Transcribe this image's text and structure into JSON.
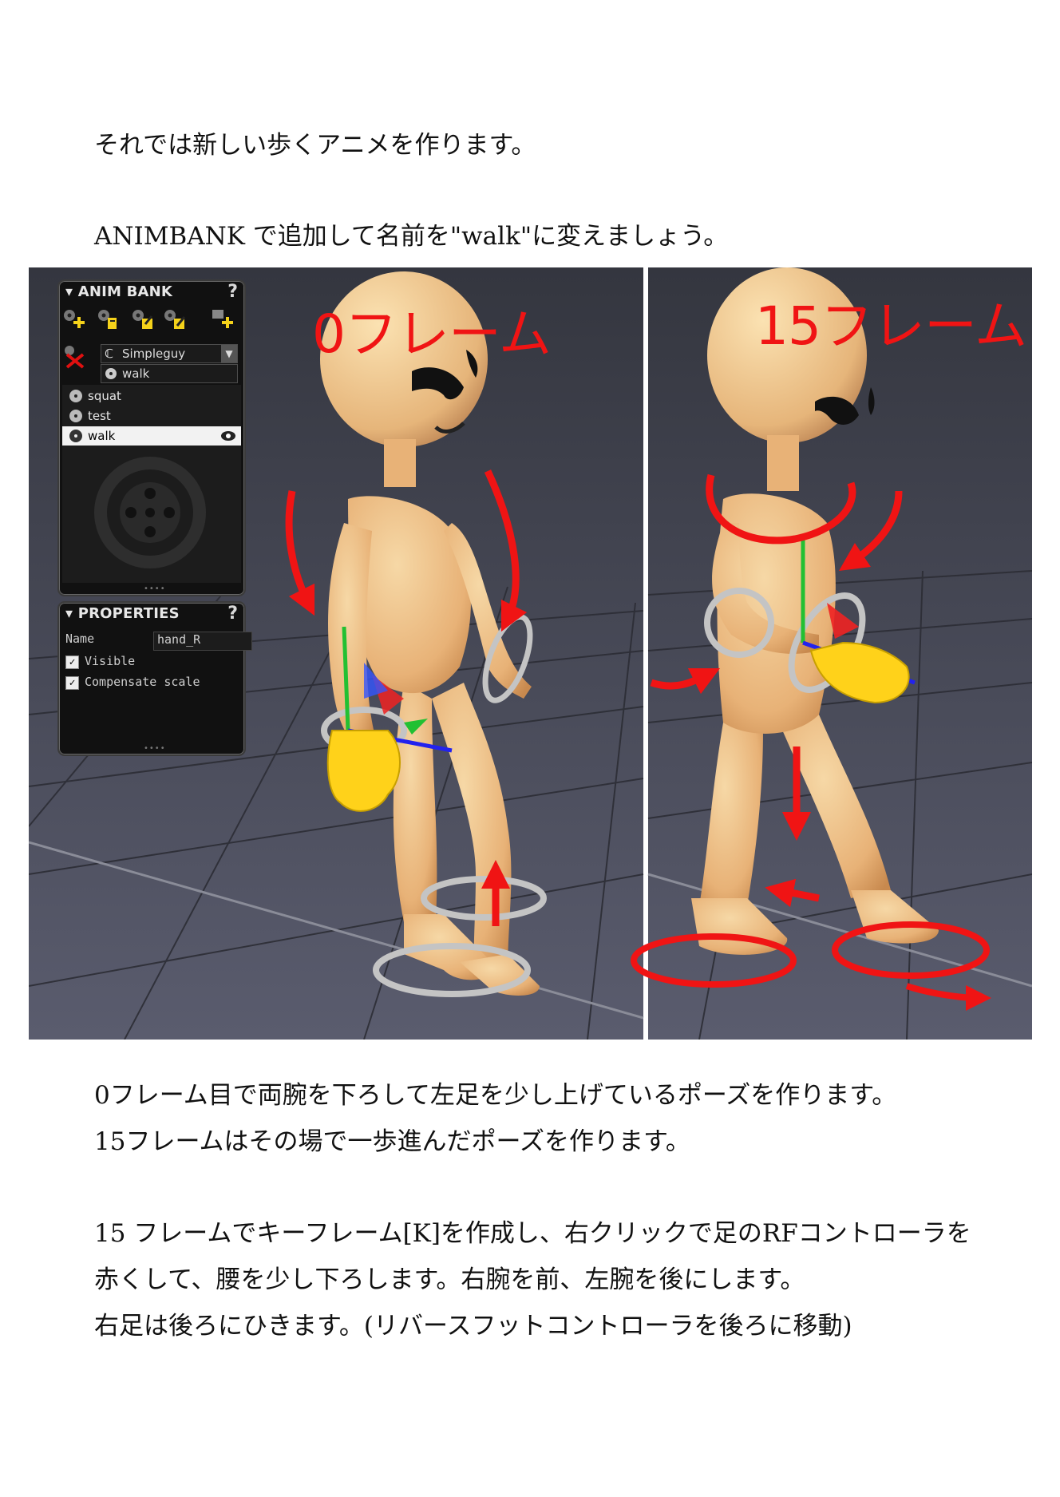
{
  "doc": {
    "line1": "それでは新しい歩くアニメを作ります。",
    "line2": "ANIMBANK で追加して名前を\"walk\"に変えましょう。",
    "line3": "0フレーム目で両腕を下ろして左足を少し上げているポーズを作ります。",
    "line4": "15フレームはその場で一歩進んだポーズを作ります。",
    "line5": "15 フレームでキーフレーム[K]を作成し、右クリックで足のRFコントローラを",
    "line6": "赤くして、腰を少し下ろします。右腕を前、左腕を後にします。",
    "line7": "右足は後ろにひきます。(リバースフットコントローラを後ろに移動)"
  },
  "screenshot": {
    "frame_labels": {
      "left": "0フレーム",
      "right": "15フレーム"
    },
    "anim_bank": {
      "title": "ANIM BANK",
      "help": "?",
      "character": "Simpleguy",
      "current_name": "walk",
      "items": [
        {
          "label": "squat",
          "selected": false
        },
        {
          "label": "test",
          "selected": false
        },
        {
          "label": "walk",
          "selected": true
        }
      ],
      "icons": [
        "add-anim-icon",
        "copy-anim-icon",
        "import-anim-icon",
        "export-anim-icon",
        "add-folder-icon",
        "delete-anim-icon"
      ]
    },
    "properties": {
      "title": "PROPERTIES",
      "help": "?",
      "name_label": "Name",
      "name_value": "hand_R",
      "visible_label": "Visible",
      "compensate_label": "Compensate scale",
      "visible_checked": true,
      "compensate_checked": true
    },
    "colors": {
      "annotation": "#f01414",
      "icon_yellow": "#f5d21a",
      "viewport_bg": "#464858",
      "skin": "#efc58e"
    }
  }
}
